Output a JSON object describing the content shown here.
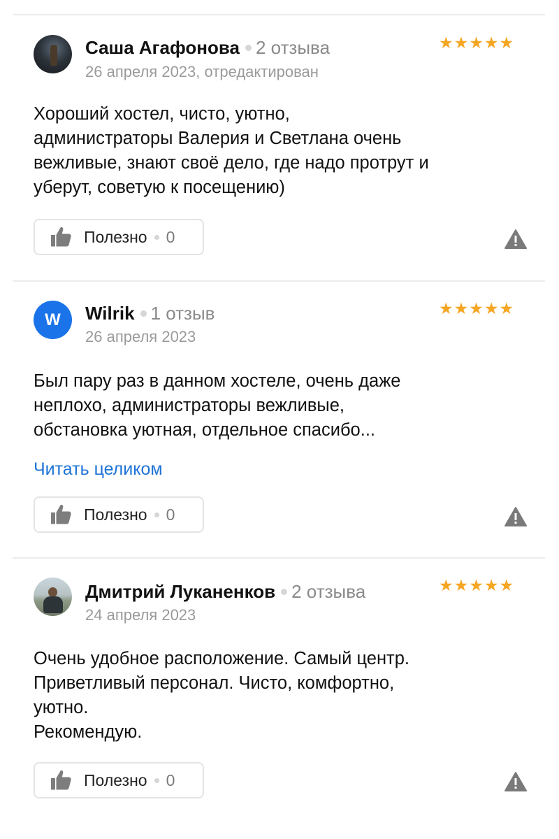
{
  "reviews": [
    {
      "author": "Саша Агафонова",
      "review_count": "2 отзыва",
      "date": "26 апреля 2023, отредактирован",
      "rating": 5,
      "stars": "★★★★★",
      "text": "Хороший хостел, чисто, уютно,\nадминистраторы Валерия и Светлана очень\nвежливые, знают своё дело, где надо протрут и\nуберут, советую к посещению)",
      "avatar": "photo",
      "helpful_label": "Полезно",
      "helpful_count": "0"
    },
    {
      "author": "Wilrik",
      "avatar_letter": "W",
      "review_count": "1 отзыв",
      "date": "26 апреля 2023",
      "rating": 5,
      "stars": "★★★★★",
      "text": "Был пару раз в данном хостеле, очень даже\nнеплохо, администраторы вежливые,\nобстановка уютная, отдельное спасибо...",
      "read_more": "Читать целиком",
      "avatar": "letter",
      "helpful_label": "Полезно",
      "helpful_count": "0"
    },
    {
      "author": "Дмитрий Луканенков",
      "review_count": "2 отзыва",
      "date": "24 апреля 2023",
      "rating": 5,
      "stars": "★★★★★",
      "text": "Очень удобное расположение. Самый центр.\nПриветливый персонал. Чисто, комфортно,\nуютно.\nРекомендую.",
      "avatar": "photo",
      "helpful_label": "Полезно",
      "helpful_count": "0"
    }
  ],
  "colors": {
    "star": "#f5a623",
    "link": "#1f74d6",
    "avatar_letter_bg": "#1a73e8",
    "muted_text": "#9a9a9a",
    "border": "#e4e4e4"
  },
  "icons": {
    "helpful": "thumbs-up-icon",
    "report": "warning-triangle-icon"
  }
}
